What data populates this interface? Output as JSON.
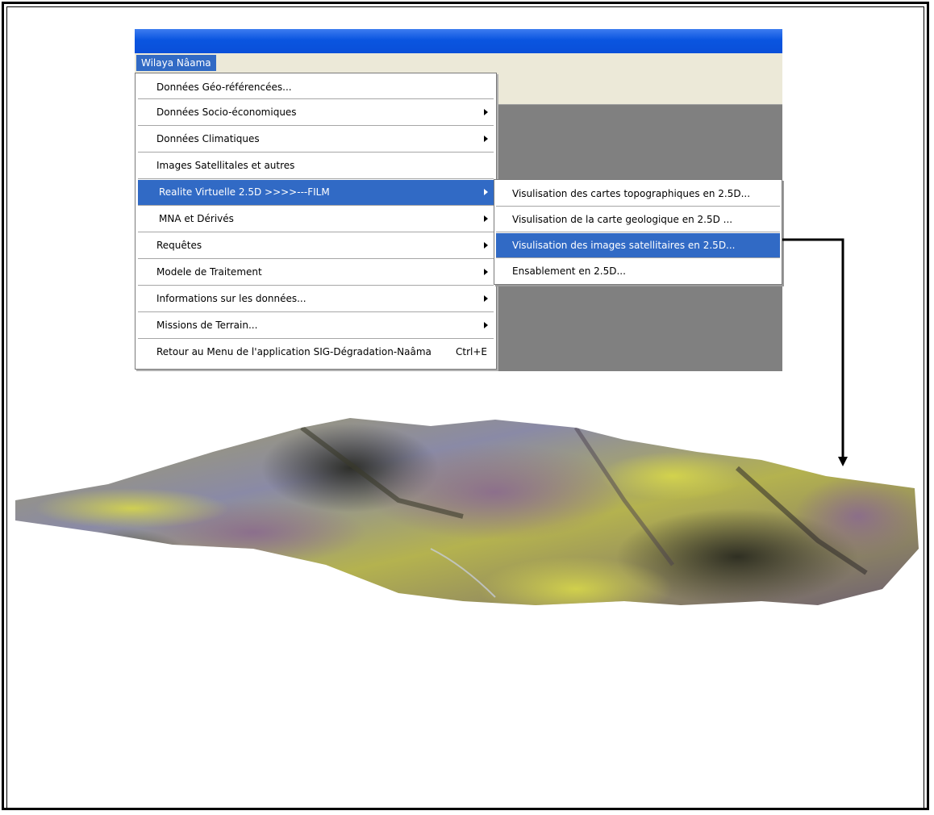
{
  "menubar": {
    "active_menu": "Wilaya Nâama"
  },
  "menu": {
    "items": [
      {
        "label": "Données Géo-référencées...",
        "submenu": false
      },
      {
        "label": "Données Socio-économiques",
        "submenu": true
      },
      {
        "label": "Données Climatiques",
        "submenu": true
      },
      {
        "label": "Images Satellitales et autres",
        "submenu": false
      },
      {
        "label": "Realite Virtuelle 2.5D >>>>---FILM",
        "submenu": true,
        "selected": true
      },
      {
        "label": "MNA et Dérivés",
        "submenu": true
      },
      {
        "label": "Requêtes",
        "submenu": true
      },
      {
        "label": "Modele de Traitement",
        "submenu": true
      },
      {
        "label": "Informations sur les données...",
        "submenu": true
      },
      {
        "label": "Missions de Terrain...",
        "submenu": true
      },
      {
        "label": "Retour au Menu de l'application SIG-Dégradation-Naâma",
        "shortcut": "Ctrl+E",
        "submenu": false
      }
    ]
  },
  "submenu": {
    "items": [
      {
        "label": "Visulisation des cartes topographiques  en 2.5D..."
      },
      {
        "label": "Visulisation de la carte geologique en 2.5D ..."
      },
      {
        "label": "Visulisation des images satellitaires en 2.5D...",
        "selected": true
      },
      {
        "label": "Ensablement en 2.5D..."
      }
    ]
  },
  "colors": {
    "selection": "#316ac5",
    "titlebar": "#0a55e0",
    "menubar": "#ece9d8",
    "workspace": "#808080"
  },
  "icons": [
    "submenu-arrow",
    "connector-arrow"
  ]
}
